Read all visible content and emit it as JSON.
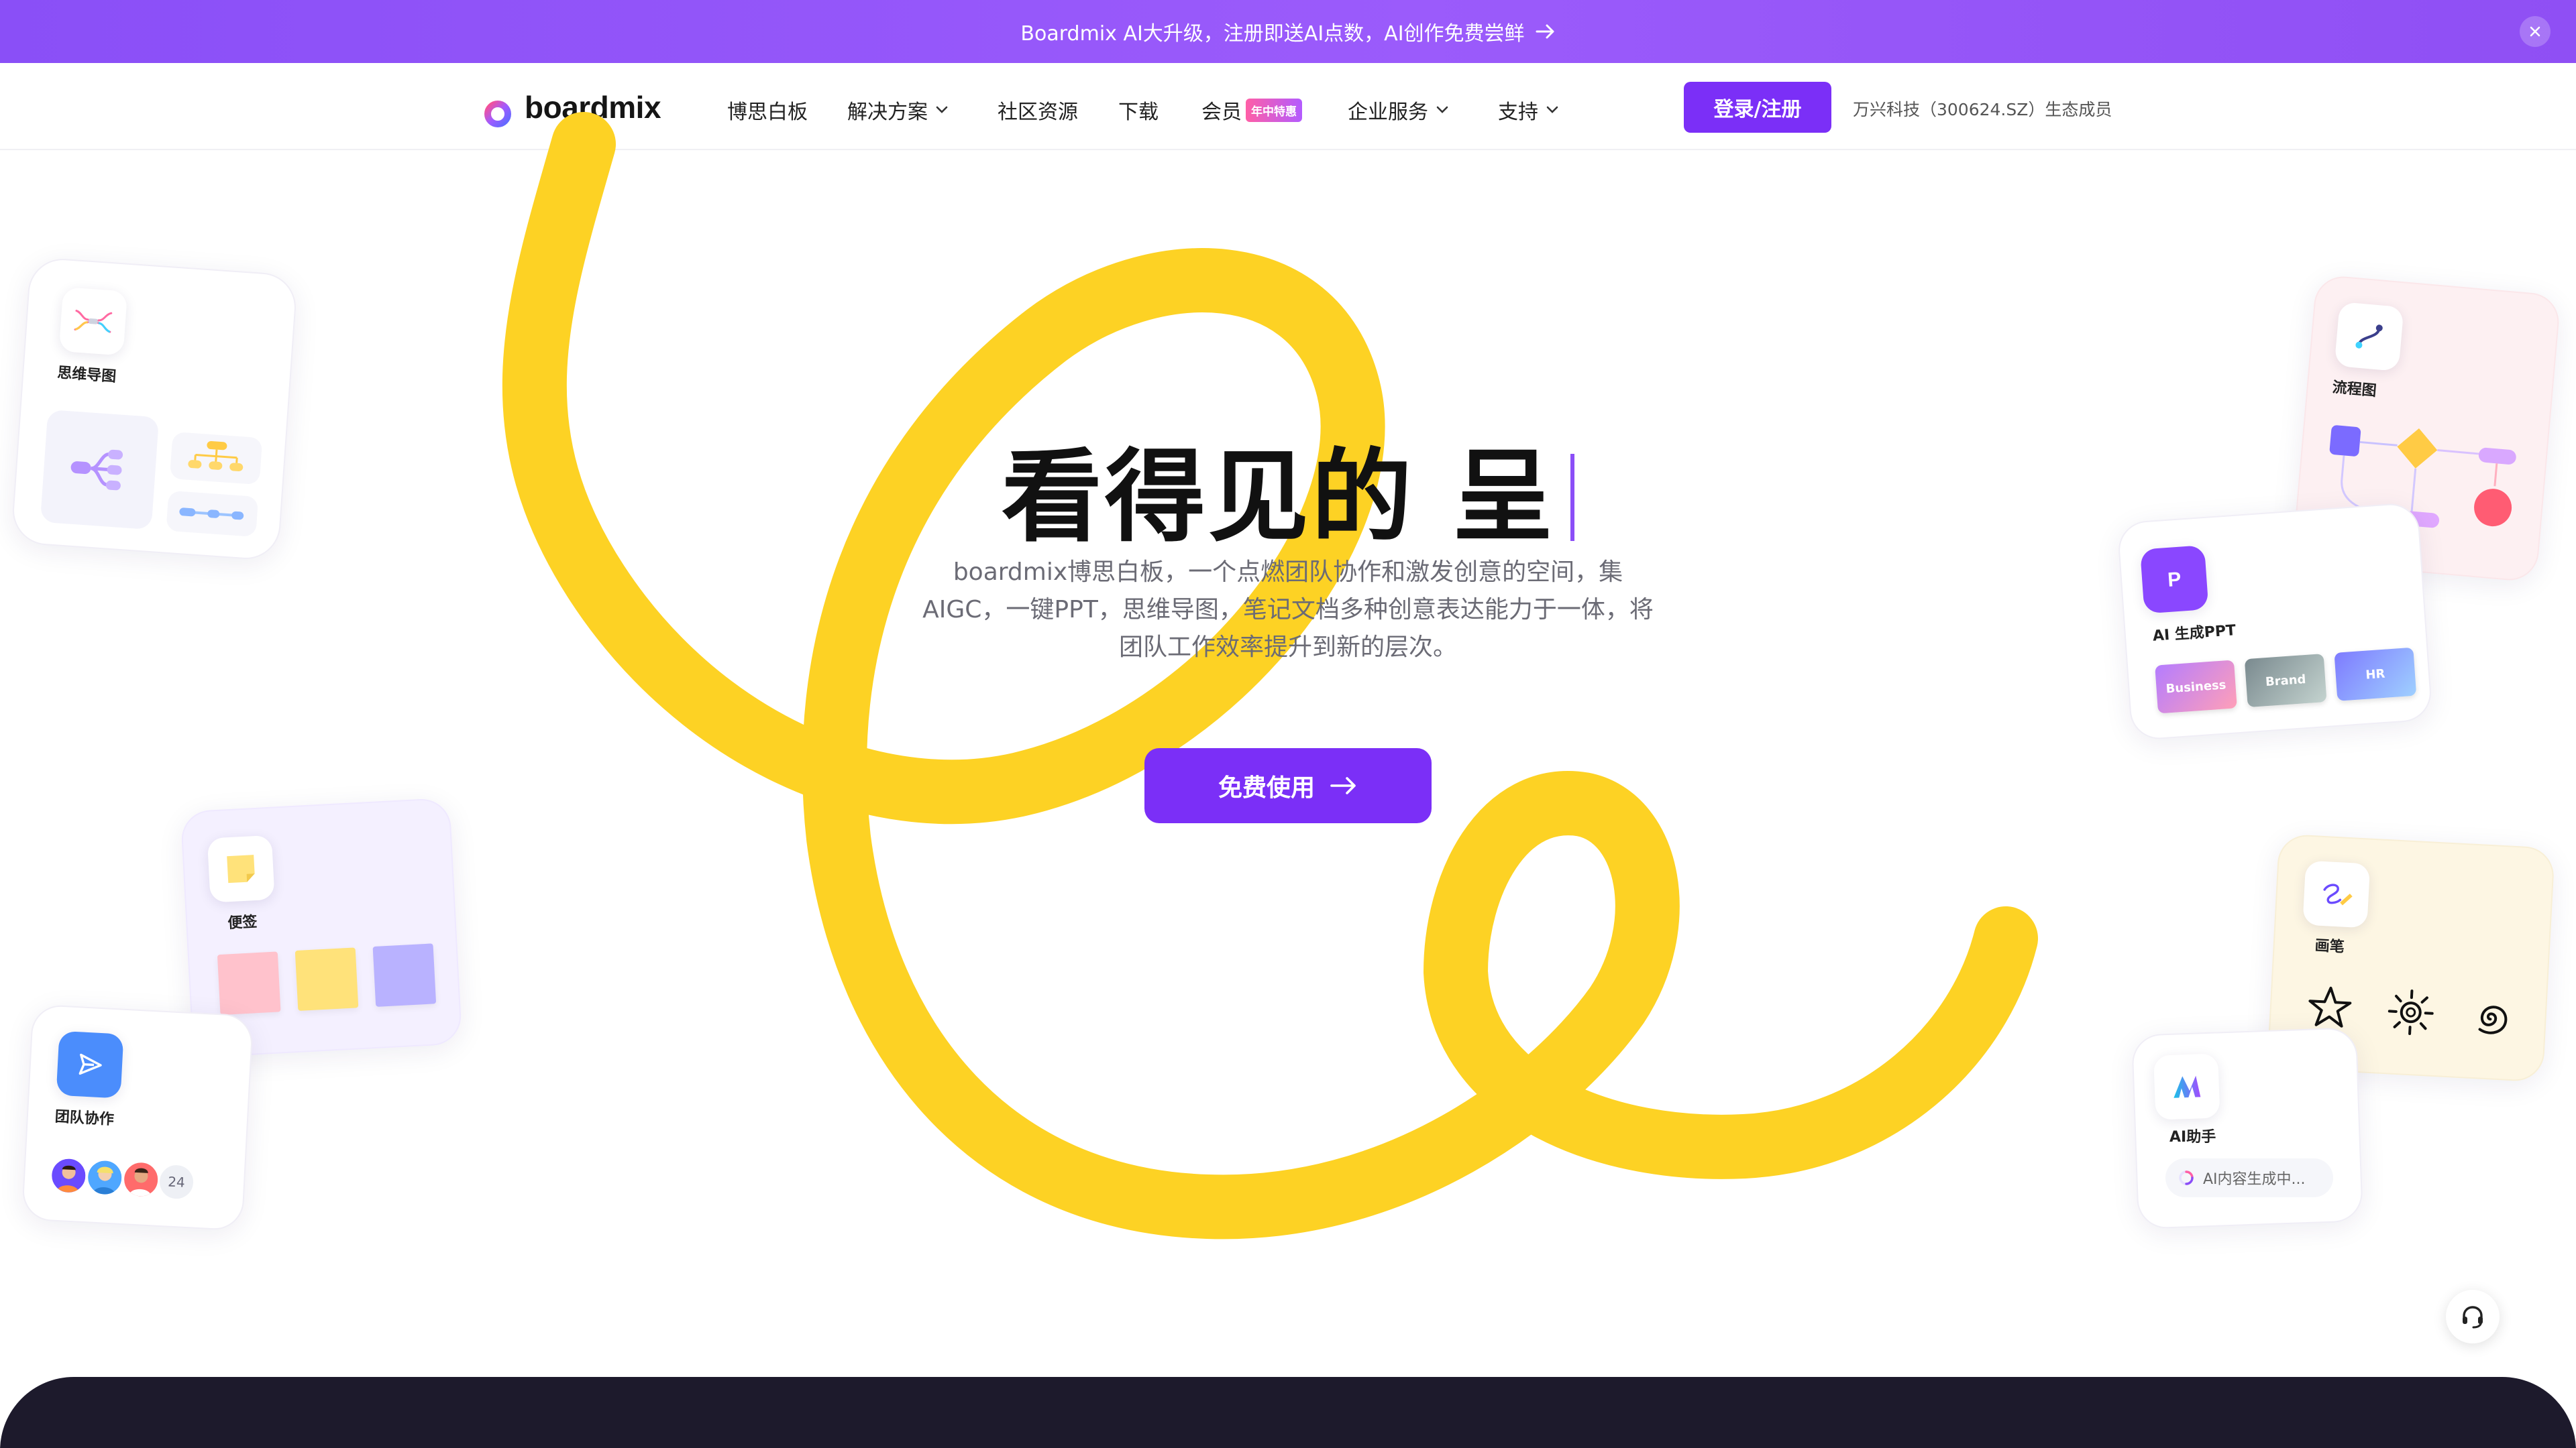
{
  "announcement": {
    "text": "Boardmix AI大升级，注册即送AI点数，AI创作免费尝鲜"
  },
  "nav": {
    "logo_text": "boardmix",
    "items": [
      {
        "label": "博思白板",
        "dropdown": false
      },
      {
        "label": "解决方案",
        "dropdown": true
      },
      {
        "label": "社区资源",
        "dropdown": false
      },
      {
        "label": "下载",
        "dropdown": false
      },
      {
        "label": "会员",
        "dropdown": false,
        "badge": "年中特惠"
      },
      {
        "label": "企业服务",
        "dropdown": true
      },
      {
        "label": "支持",
        "dropdown": true
      }
    ],
    "login_label": "登录/注册",
    "eco_text": "万兴科技（300624.SZ）生态成员"
  },
  "hero": {
    "title": "看得见的 呈",
    "subtitle": "boardmix博思白板，一个点燃团队协作和激发创意的空间，集AIGC，一键PPT，思维导图，笔记文档多种创意表达能力于一体，将团队工作效率提升到新的层次。",
    "cta_label": "免费使用"
  },
  "cards": {
    "mindmap": {
      "label": "思维导图"
    },
    "sticky": {
      "label": "便签",
      "note_colors": [
        "#ffc2cc",
        "#ffe27a",
        "#b9b2ff"
      ]
    },
    "team": {
      "label": "团队协作",
      "more_count": "24"
    },
    "flowchart": {
      "label": "流程图"
    },
    "ai_ppt": {
      "label": "AI 生成PPT",
      "thumbnails": [
        "Business",
        "Brand",
        "HR"
      ]
    },
    "pen": {
      "label": "画笔"
    },
    "ai_assistant": {
      "label": "AI助手",
      "status": "AI内容生成中..."
    }
  },
  "colors": {
    "brand_purple": "#7b2ff7",
    "scribble_yellow": "#fdd224",
    "footer_dark": "#1d1a2c"
  }
}
